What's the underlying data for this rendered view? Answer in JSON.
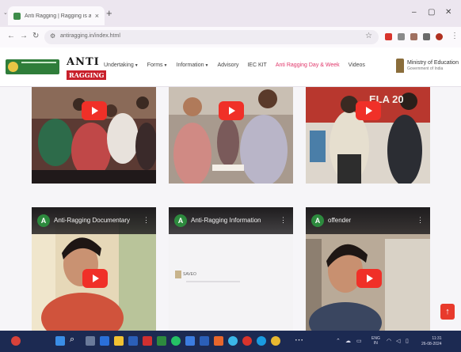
{
  "browser": {
    "tab_title": "Anti Ragging | Ragging is a crim",
    "tab_close": "×",
    "tab_menu": "⌄",
    "new_tab": "+",
    "url": "antiragging.in/index.html",
    "window_min": "–",
    "window_max": "▢",
    "window_close": "✕"
  },
  "site": {
    "ugc_logo_alt": "University Grants Commission",
    "anti_logo_line1": "ANTI",
    "anti_logo_line2": "RAGGING",
    "nav": [
      {
        "label": "Undertaking",
        "dropdown": true
      },
      {
        "label": "Forms",
        "dropdown": true
      },
      {
        "label": "Information",
        "dropdown": true
      },
      {
        "label": "Advisory",
        "dropdown": false
      },
      {
        "label": "IEC KIT",
        "dropdown": false
      },
      {
        "label": "Anti Ragging Day & Week",
        "dropdown": false,
        "active": true
      },
      {
        "label": "Videos",
        "dropdown": false
      }
    ],
    "ministry": "Ministry of Education",
    "ministry_sub": "Government of India"
  },
  "videos": {
    "top_banner_text": "ELA 20",
    "cards": [
      {
        "title": "Anti-Ragging Documentary",
        "avatar": "A"
      },
      {
        "title": "Anti-Ragging Information",
        "avatar": "A",
        "doc_label": "SAVEO"
      },
      {
        "title": "offender",
        "avatar": "A"
      }
    ],
    "menu_glyph": "⋮"
  },
  "scroll_top": "↑",
  "taskbar": {
    "lang": "ENG",
    "lang_sub": "IN",
    "time": "11:31",
    "date": "26-08-2024"
  },
  "colors": {
    "accent_pink": "#e0366a",
    "youtube_red": "#f03028",
    "ugc_green": "#2f7d3a",
    "taskbar": "#1c2a52"
  }
}
